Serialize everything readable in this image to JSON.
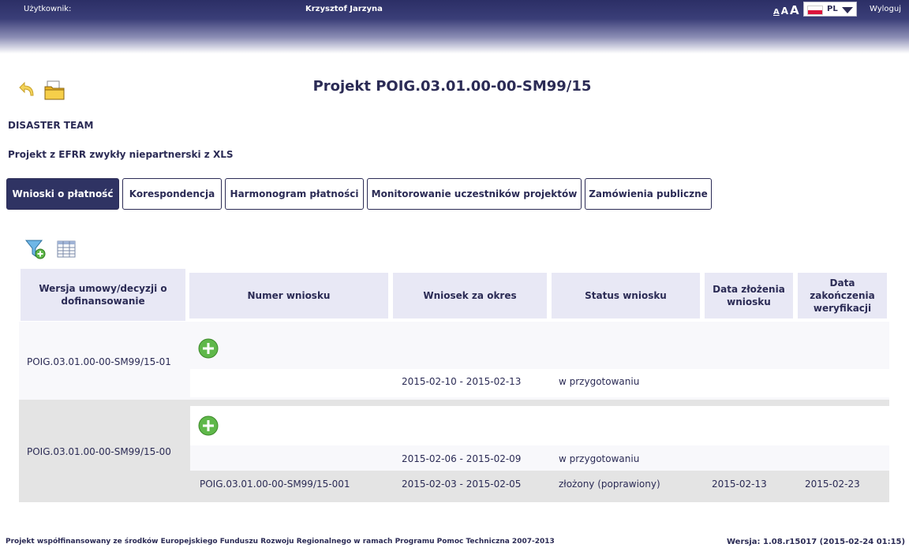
{
  "header": {
    "user_label": "Użytkownik:",
    "user_name": "Krzysztof Jarzyna",
    "font_size_small": "A",
    "font_size_medium": "A",
    "font_size_large": "A",
    "language": "PL",
    "logout": "Wyloguj"
  },
  "page": {
    "title": "Projekt POIG.03.01.00-00-SM99/15",
    "organization": "DISASTER TEAM",
    "project_type": "Projekt z EFRR zwykły niepartnerski z XLS"
  },
  "tabs": [
    {
      "label": "Wnioski o płatność",
      "active": true
    },
    {
      "label": "Korespondencja",
      "active": false
    },
    {
      "label": "Harmonogram płatności",
      "active": false
    },
    {
      "label": "Monitorowanie uczestników projektów",
      "active": false
    },
    {
      "label": "Zamówienia publiczne",
      "active": false
    }
  ],
  "table": {
    "headers": {
      "version": "Wersja umowy/decyzji o dofinansowanie",
      "number": "Numer wniosku",
      "period": "Wniosek za okres",
      "status": "Status wniosku",
      "submitted": "Data złożenia wniosku",
      "verified": "Data zakończenia weryfikacji"
    },
    "groups": [
      {
        "version": "POIG.03.01.00-00-SM99/15-01",
        "rows": [
          {
            "number": "",
            "period": "2015-02-10 - 2015-02-13",
            "status": "w przygotowaniu",
            "submitted": "",
            "verified": ""
          }
        ]
      },
      {
        "version": "POIG.03.01.00-00-SM99/15-00",
        "rows": [
          {
            "number": "",
            "period": "2015-02-06 - 2015-02-09",
            "status": "w przygotowaniu",
            "submitted": "",
            "verified": ""
          },
          {
            "number": "POIG.03.01.00-00-SM99/15-001",
            "period": "2015-02-03 - 2015-02-05",
            "status": "złożony (poprawiony)",
            "submitted": "2015-02-13",
            "verified": "2015-02-23"
          }
        ]
      }
    ]
  },
  "footer": {
    "left": "Projekt współfinansowany ze środków Europejskiego Funduszu Rozwoju Regionalnego w ramach Programu Pomoc Techniczna 2007-2013",
    "right": "Wersja: 1.08.r15017 (2015-02-24 01:15)"
  },
  "icons": {
    "back": "undo-arrow-icon",
    "folder": "folder-icon",
    "filter": "filter-add-icon",
    "columns": "table-columns-icon",
    "add": "plus-circle-icon"
  }
}
